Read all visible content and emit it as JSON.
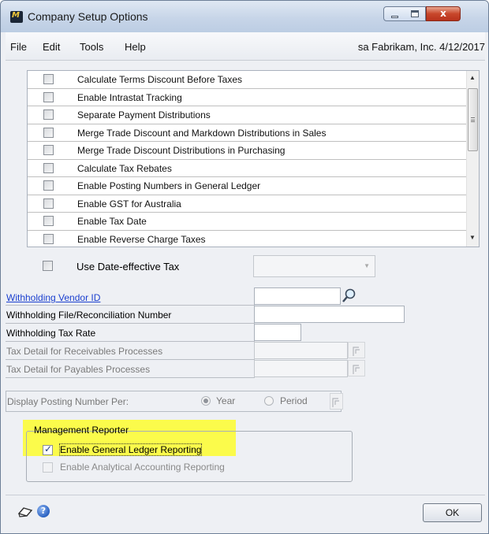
{
  "window": {
    "title": "Company Setup Options",
    "close_glyph": "x"
  },
  "menu": {
    "items": [
      "File",
      "Edit",
      "Tools",
      "Help"
    ],
    "status": "sa  Fabrikam, Inc. 4/12/2017"
  },
  "options": {
    "items": [
      {
        "label": "Calculate Terms Discount Before Taxes",
        "checked": false
      },
      {
        "label": "Enable Intrastat Tracking",
        "checked": false
      },
      {
        "label": "Separate Payment Distributions",
        "checked": false
      },
      {
        "label": "Merge Trade Discount and Markdown Distributions in Sales",
        "checked": false
      },
      {
        "label": "Merge Trade Discount Distributions in Purchasing",
        "checked": false
      },
      {
        "label": "Calculate Tax Rebates",
        "checked": false
      },
      {
        "label": "Enable Posting Numbers in General Ledger",
        "checked": false
      },
      {
        "label": "Enable GST for Australia",
        "checked": false
      },
      {
        "label": "Enable Tax Date",
        "checked": false
      },
      {
        "label": "Enable Reverse Charge Taxes",
        "checked": false
      }
    ]
  },
  "date_effective": {
    "label": "Use Date-effective Tax",
    "checked": false,
    "selected_value": ""
  },
  "form": {
    "withholding_vendor_id_label": "Withholding Vendor ID",
    "withholding_vendor_id_value": "",
    "file_number_label": "Withholding File/Reconciliation Number",
    "file_number_value": "",
    "tax_rate_label": "Withholding Tax Rate",
    "tax_rate_value": "",
    "receivables_label": "Tax Detail for Receivables Processes",
    "receivables_value": "",
    "payables_label": "Tax Detail for Payables Processes",
    "payables_value": ""
  },
  "posting": {
    "label": "Display Posting Number Per:",
    "options": [
      "Year",
      "Period"
    ],
    "selected": "Year"
  },
  "management_reporter": {
    "title": "Management Reporter",
    "gl_label": "Enable General Ledger Reporting",
    "gl_checked": true,
    "aa_label": "Enable Analytical Accounting Reporting",
    "aa_checked": false,
    "highlight_color": "#fbfb4b"
  },
  "footer": {
    "ok_label": "OK",
    "icons": [
      "note-icon",
      "help-icon"
    ],
    "help_glyph": "?"
  }
}
